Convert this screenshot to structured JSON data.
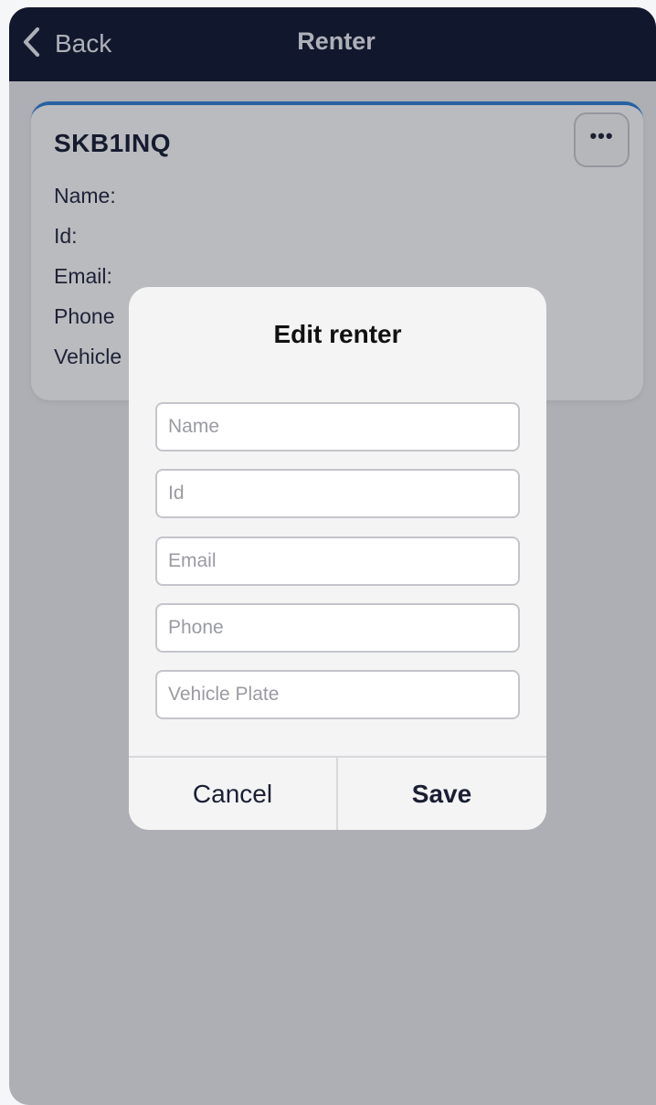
{
  "navbar": {
    "back_label": "Back",
    "title": "Renter"
  },
  "card": {
    "title": "SKB1INQ",
    "more_label": "•••",
    "fields": {
      "name": "Name:",
      "id": "Id:",
      "email": "Email:",
      "phone": "Phone",
      "vehicle": "Vehicle"
    }
  },
  "dialog": {
    "title": "Edit renter",
    "inputs": {
      "name_placeholder": "Name",
      "id_placeholder": "Id",
      "email_placeholder": "Email",
      "phone_placeholder": "Phone",
      "plate_placeholder": "Vehicle Plate"
    },
    "cancel_label": "Cancel",
    "save_label": "Save"
  },
  "colors": {
    "navbar_bg": "#0e1630",
    "card_accent": "#2f7fd6",
    "overlay": "#1c1e28"
  }
}
